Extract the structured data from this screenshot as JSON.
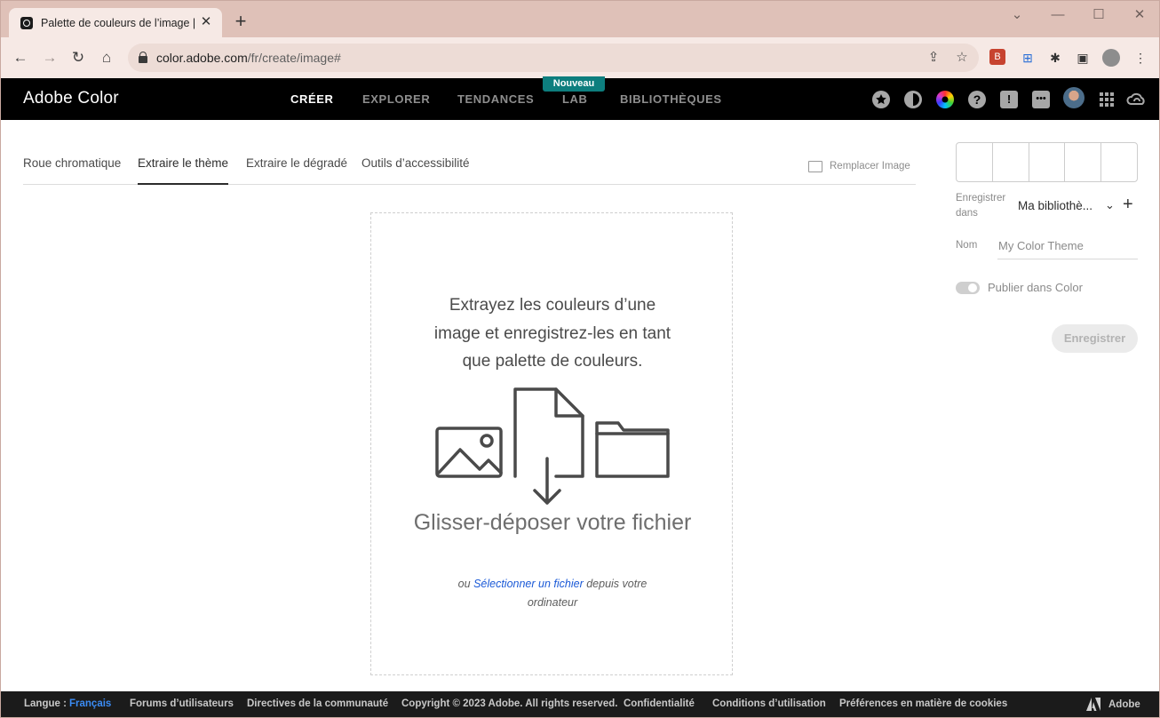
{
  "browser": {
    "tab_title": "Palette de couleurs de l’image | A",
    "url_domain": "color.adobe.com",
    "url_path": "/fr/create/image#"
  },
  "header": {
    "brand": "Adobe Color",
    "nav": [
      "CRÉER",
      "EXPLORER",
      "TENDANCES",
      "LAB",
      "BIBLIOTHÈQUES"
    ],
    "badge": "Nouveau"
  },
  "tabs": [
    "Roue chromatique",
    "Extraire le thème",
    "Extraire le dégradé",
    "Outils d’accessibilité"
  ],
  "replace_image": "Remplacer Image",
  "dropzone": {
    "intro": "Extrayez les couleurs d’une image et enregistrez-les en tant que palette de couleurs.",
    "title": "Glisser-déposer votre fichier",
    "or": "ou ",
    "link": "Sélectionner un fichier",
    "rest": " depuis votre ordinateur"
  },
  "panel": {
    "save_in_label": "Enregistrer dans",
    "library": "Ma bibliothè...",
    "name_label": "Nom",
    "name_placeholder": "My Color Theme",
    "publish_label": "Publier dans Color",
    "save_button": "Enregistrer"
  },
  "footer": {
    "lang_label": "Langue :",
    "lang_value": "Français",
    "links": [
      "Forums d’utilisateurs",
      "Directives de la communauté",
      "Copyright © 2023 Adobe. All rights reserved.",
      "Confidentialité",
      "Conditions d’utilisation",
      "Préférences en matière de cookies"
    ],
    "adobe": "Adobe"
  }
}
